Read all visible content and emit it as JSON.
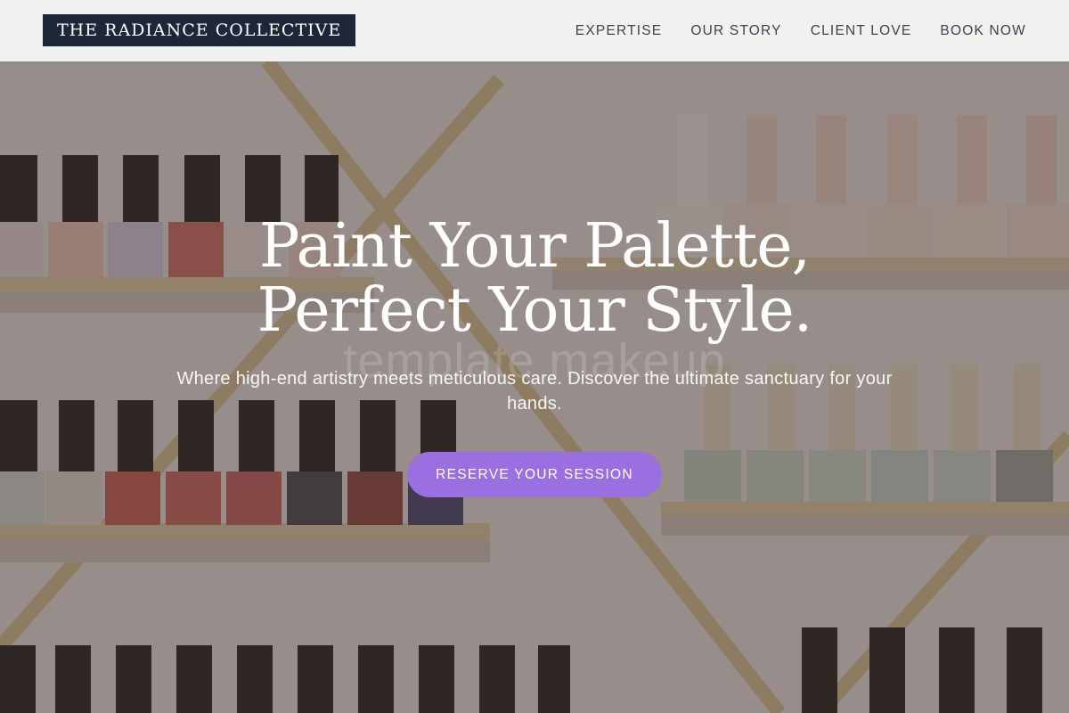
{
  "header": {
    "logo": "THE RADIANCE COLLECTIVE",
    "nav": [
      {
        "label": "EXPERTISE"
      },
      {
        "label": "OUR STORY"
      },
      {
        "label": "CLIENT LOVE"
      },
      {
        "label": "BOOK NOW"
      }
    ]
  },
  "hero": {
    "headline_line1": "Paint Your Palette,",
    "headline_line2": "Perfect Your Style.",
    "watermark": "template makeup",
    "subtext": "Where high-end artistry meets meticulous care. Discover the ultimate sanctuary for your hands.",
    "cta_label": "RESERVE YOUR SESSION"
  },
  "colors": {
    "logo_bg": "#1e2738",
    "cta_bg": "#9a6fe0",
    "header_bg": "#f5f5f4",
    "nav_text": "#3c4350"
  }
}
